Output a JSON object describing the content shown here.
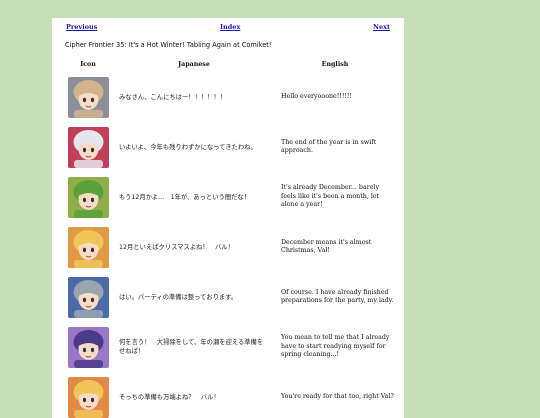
{
  "nav": {
    "previous": "Previous",
    "index": "Index",
    "next": "Next"
  },
  "title": "Cipher Frontier 35: It's a Hot Winter! Tabling Again at Comiket!",
  "table": {
    "headers": {
      "icon": "Icon",
      "japanese": "Japanese",
      "english": "English"
    },
    "rows": [
      {
        "icon": "group-portrait-icon",
        "bg": "#8a8f9a",
        "hair": "#d2b48c",
        "japanese": "みなさん、こんにちはー！！！！！！",
        "english": "Hello everyooone!!!!!!"
      },
      {
        "icon": "silver-hair-girl-icon",
        "bg": "#c0405a",
        "hair": "#e6e6ef",
        "japanese": "いよいよ、今年も残りわずかになってきたわね。",
        "english": "The end of the year is in swift approach."
      },
      {
        "icon": "green-hair-girl-icon",
        "bg": "#8fae4a",
        "hair": "#5aa13a",
        "japanese": "もう12月かよ…　1年が、あっという間だな！",
        "english": "It's already December... barely feels like it's been a month, let alone a year!"
      },
      {
        "icon": "blonde-girl-icon",
        "bg": "#e09a45",
        "hair": "#f2c45a",
        "japanese": "12月といえばクリスマスよね！　バル！",
        "english": "December means it's almost Christmas, Val!"
      },
      {
        "icon": "armored-knight-icon",
        "bg": "#4a6aa8",
        "hair": "#9aa4b0",
        "japanese": "はい。パーティの準備は整っております。",
        "english": "Of course. I have already finished preparations for the party, my lady."
      },
      {
        "icon": "purple-hair-girl-icon",
        "bg": "#9a78c8",
        "hair": "#4a3a8a",
        "japanese": "何を言う！　大掃除をして、年の瀬を迎える準備をせねば！",
        "english": "You mean to tell me that I already have to start readying myself for spring cleaning...!"
      },
      {
        "icon": "blonde-girl-icon",
        "bg": "#e08a45",
        "hair": "#f2c45a",
        "japanese": "そっちの準備も万端よね？　バル！",
        "english": "You're ready for that too, right Val?"
      }
    ]
  }
}
